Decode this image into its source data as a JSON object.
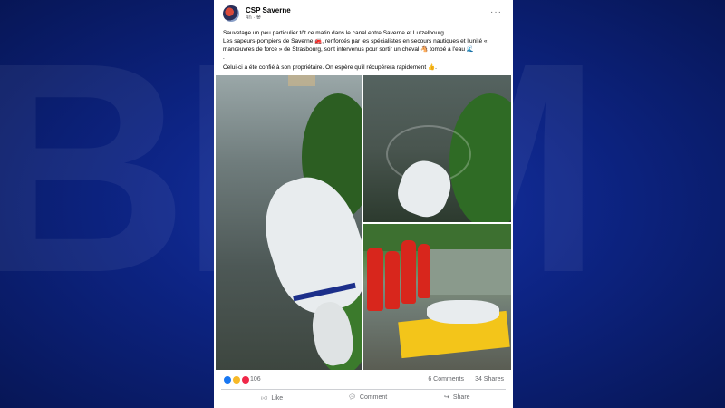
{
  "background": {
    "letters": "BFM",
    "color": "#0d2484"
  },
  "post": {
    "page_name": "CSP Saverne",
    "time": "4h · ",
    "globe_icon": "globe-icon",
    "more_label": "···",
    "text_lines": [
      "Sauvetage un peu particulier tôt ce matin dans le canal entre Saverne et Lutzelbourg.",
      "Les sapeurs-pompiers de Saverne 🚒, renforcés par les spécialistes en secours nautiques et l'unité « manœuvres de force » de Strasbourg, sont intervenus pour sortir un cheval 🐴 tombé à l'eau 🌊",
      ".",
      "Celui-ci a été confié à son propriétaire. On espère qu'il récupérera rapidement 👍."
    ],
    "reactions": {
      "count": "106",
      "comments": "6 Comments",
      "shares": "34 Shares"
    },
    "actions": {
      "like": "Like",
      "comment": "Comment",
      "share": "Share"
    }
  }
}
